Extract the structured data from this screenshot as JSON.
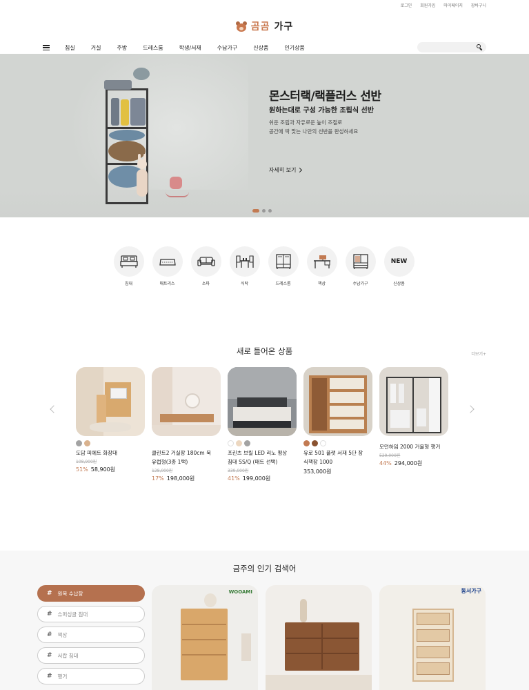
{
  "util_links": [
    "로그인",
    "회원가입",
    "마이페이지",
    "장바구니"
  ],
  "logo": {
    "part1": "곰곰",
    "part2": "가구"
  },
  "nav": {
    "items": [
      "침실",
      "거실",
      "주방",
      "드레스룸",
      "학생/서재",
      "수납가구",
      "신상품",
      "인기상품"
    ],
    "search_placeholder": ""
  },
  "hero": {
    "title": "몬스터랙/랙플러스 선반",
    "subtitle": "원하는대로 구성 가능한 조립식 선반",
    "desc_line1": "쉬운 조립과 자유로운 높이 조절로",
    "desc_line2": "공간에 딱 맞는 나만의 선반을 완성하세요",
    "more": "자세히 보기",
    "slides": 3,
    "active_slide": 1
  },
  "categories": [
    {
      "label": "침대",
      "icon": "bed-icon"
    },
    {
      "label": "매트리스",
      "icon": "mattress-icon"
    },
    {
      "label": "소파",
      "icon": "sofa-icon"
    },
    {
      "label": "식탁",
      "icon": "dining-table-icon"
    },
    {
      "label": "드레스룸",
      "icon": "wardrobe-icon"
    },
    {
      "label": "책상",
      "icon": "desk-icon"
    },
    {
      "label": "수납가구",
      "icon": "storage-icon"
    },
    {
      "label": "신상품",
      "icon_text": "NEW"
    }
  ],
  "new_products": {
    "title": "새로 들어온 상품",
    "more": "더보기+",
    "items": [
      {
        "name_line1": "도담 피에트 화장대",
        "name_line2": "",
        "original": "108,900원",
        "rate": "51%",
        "price": "58,900원",
        "swatches": [
          "#a3a3a3",
          "#d9b28e"
        ]
      },
      {
        "name_line1": "클린트2 거실장 180cm 북",
        "name_line2": "유럽형(3종 1택)",
        "original": "128,000원",
        "rate": "17%",
        "price": "198,000원",
        "swatches": []
      },
      {
        "name_line1": "프린츠 브릴 LED 리노 평상",
        "name_line2": "침대 SS/Q (매트 선택)",
        "original": "339,000원",
        "rate": "41%",
        "price": "199,000원",
        "swatches": [
          "#ffffff",
          "#ecd7c0",
          "#a3a3a3"
        ]
      },
      {
        "name_line1": "유로 501 플랫 서재 5단 장",
        "name_line2": "식책장 1000",
        "original": "",
        "rate": "",
        "price": "353,000원",
        "swatches": [
          "#c27a52",
          "#8a5230",
          "#ffffff"
        ]
      },
      {
        "name_line1": "모던하임 2000 거울형 행거",
        "name_line2": "",
        "original": "529,000원",
        "rate": "44%",
        "price": "294,000원",
        "swatches": []
      }
    ]
  },
  "popular": {
    "title": "금주의 인기 검색어",
    "keywords": [
      "원목 수납장",
      "슈퍼싱글 침대",
      "책상",
      "서랍 침대",
      "행거"
    ],
    "active_index": 0,
    "brands": [
      "WOOAMI",
      "",
      "동서가구"
    ]
  },
  "colors": {
    "accent": "#b5714f",
    "hero_bg": "#d2d5d2"
  }
}
